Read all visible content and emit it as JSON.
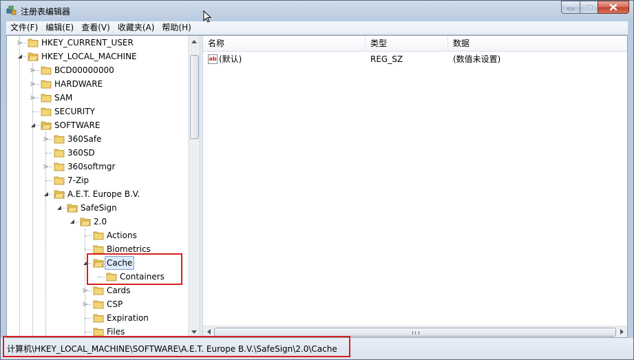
{
  "window": {
    "title": "注册表编辑器",
    "buttons": {
      "minimize": "minimize",
      "maximize": "maximize",
      "close": "close"
    }
  },
  "menu": [
    "文件(F)",
    "编辑(E)",
    "查看(V)",
    "收藏夹(A)",
    "帮助(H)"
  ],
  "tree": [
    {
      "label": "HKEY_CURRENT_USER",
      "level": 0,
      "expander": "collapsed"
    },
    {
      "label": "HKEY_LOCAL_MACHINE",
      "level": 0,
      "expander": "expanded"
    },
    {
      "label": "BCD00000000",
      "level": 1,
      "expander": "collapsed"
    },
    {
      "label": "HARDWARE",
      "level": 1,
      "expander": "collapsed"
    },
    {
      "label": "SAM",
      "level": 1,
      "expander": "collapsed"
    },
    {
      "label": "SECURITY",
      "level": 1,
      "expander": "none"
    },
    {
      "label": "SOFTWARE",
      "level": 1,
      "expander": "expanded"
    },
    {
      "label": "360Safe",
      "level": 2,
      "expander": "collapsed"
    },
    {
      "label": "360SD",
      "level": 2,
      "expander": "none"
    },
    {
      "label": "360softmgr",
      "level": 2,
      "expander": "collapsed"
    },
    {
      "label": "7-Zip",
      "level": 2,
      "expander": "none"
    },
    {
      "label": "A.E.T. Europe B.V.",
      "level": 2,
      "expander": "expanded"
    },
    {
      "label": "SafeSign",
      "level": 3,
      "expander": "expanded"
    },
    {
      "label": "2.0",
      "level": 4,
      "expander": "expanded"
    },
    {
      "label": "Actions",
      "level": 5,
      "expander": "none"
    },
    {
      "label": "Biometrics",
      "level": 5,
      "expander": "none"
    },
    {
      "label": "Cache",
      "level": 5,
      "expander": "expanded",
      "selected": true
    },
    {
      "label": "Containers",
      "level": 6,
      "expander": "none"
    },
    {
      "label": "Cards",
      "level": 5,
      "expander": "collapsed"
    },
    {
      "label": "CSP",
      "level": 5,
      "expander": "collapsed"
    },
    {
      "label": "Expiration",
      "level": 5,
      "expander": "none"
    },
    {
      "label": "Files",
      "level": 5,
      "expander": "none"
    }
  ],
  "list": {
    "columns": [
      "名称",
      "类型",
      "数据"
    ],
    "rows": [
      {
        "icon": "ab",
        "name": "(默认)",
        "type": "REG_SZ",
        "data": "(数值未设置)"
      }
    ]
  },
  "status": {
    "path": "计算机\\HKEY_LOCAL_MACHINE\\SOFTWARE\\A.E.T. Europe B.V.\\SafeSign\\2.0\\Cache"
  },
  "colors": {
    "highlight": "#d81e1e",
    "selection": "#dcebfc",
    "folder": "#e8c35a"
  }
}
